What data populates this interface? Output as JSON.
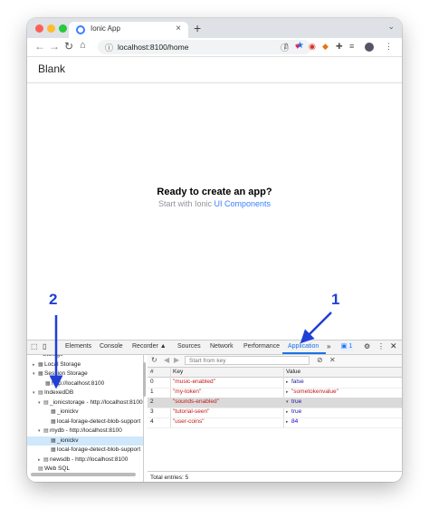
{
  "browser": {
    "tab_title": "Ionic App",
    "url": "localhost:8100/home",
    "new_tab_label": "+",
    "tab_close_label": "×"
  },
  "app": {
    "header_title": "Blank",
    "ready_text": "Ready to create an app?",
    "start_prefix": "Start with Ionic ",
    "start_link": "UI Components"
  },
  "devtools": {
    "tabs": [
      "Elements",
      "Console",
      "Recorder ▲",
      "Sources",
      "Network",
      "Performance",
      "Application"
    ],
    "active_tab": "Application",
    "more_label": "»",
    "issues_count": "1",
    "filter_placeholder": "Start from key",
    "sidebar": [
      {
        "label": "Storage",
        "arrow": "",
        "icon": ""
      },
      {
        "label": "Local Storage",
        "arrow": "▸",
        "icon": "▦"
      },
      {
        "label": "Session Storage",
        "arrow": "▾",
        "icon": "▦"
      },
      {
        "label": "http://localhost:8100",
        "arrow": "",
        "icon": "▦"
      },
      {
        "label": "IndexedDB",
        "arrow": "▾",
        "icon": "▤"
      },
      {
        "label": "_ionicstorage - http://localhost:8100",
        "arrow": "▾",
        "icon": "▤"
      },
      {
        "label": "_ionickv",
        "arrow": "",
        "icon": "▦"
      },
      {
        "label": "local-forage-detect-blob-support",
        "arrow": "",
        "icon": "▦"
      },
      {
        "label": "mydb - http://localhost:8100",
        "arrow": "▾",
        "icon": "▤"
      },
      {
        "label": "_ionickv",
        "arrow": "",
        "icon": "▦"
      },
      {
        "label": "local-forage-detect-blob-support",
        "arrow": "",
        "icon": "▦"
      },
      {
        "label": "newsdb - http://localhost:8100",
        "arrow": "▸",
        "icon": "▤"
      },
      {
        "label": "Web SQL",
        "arrow": "",
        "icon": "▤"
      }
    ],
    "selected_sidebar_index": 9,
    "table": {
      "headers": [
        "#",
        "Key",
        "Value"
      ],
      "rows": [
        {
          "index": "0",
          "key": "\"music-enabled\"",
          "arrow": "▸",
          "value": "false",
          "vtype": "bool"
        },
        {
          "index": "1",
          "key": "\"my-token\"",
          "arrow": "▸",
          "value": "\"sometokenvalue\"",
          "vtype": "str"
        },
        {
          "index": "2",
          "key": "\"sounds-enabled\"",
          "arrow": "▾",
          "value": "true",
          "vtype": "bool"
        },
        {
          "index": "3",
          "key": "\"tutorial-seen\"",
          "arrow": "▸",
          "value": "true",
          "vtype": "bool"
        },
        {
          "index": "4",
          "key": "\"user-coins\"",
          "arrow": "▸",
          "value": "84",
          "vtype": "num"
        }
      ],
      "selected_row": 2
    },
    "footer": "Total entries: 5"
  },
  "annotations": [
    "1",
    "2"
  ],
  "colors": {
    "accent": "#1a73e8",
    "ionic_link": "#3880ff",
    "annotation": "#1f3fd6"
  }
}
